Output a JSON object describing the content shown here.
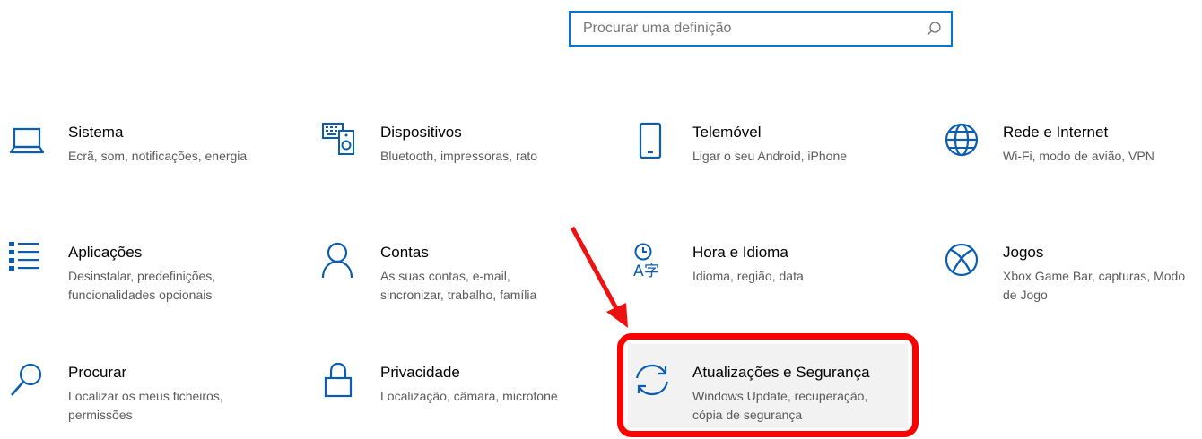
{
  "search": {
    "placeholder": "Procurar uma definição"
  },
  "tiles": [
    {
      "title": "Sistema",
      "desc": "Ecrã, som, notificações, energia",
      "icon": "laptop-icon"
    },
    {
      "title": "Dispositivos",
      "desc": "Bluetooth, impressoras, rato",
      "icon": "keyboard-speaker-icon"
    },
    {
      "title": "Telemóvel",
      "desc": "Ligar o seu Android, iPhone",
      "icon": "phone-icon"
    },
    {
      "title": "Rede e Internet",
      "desc": "Wi-Fi, modo de avião, VPN",
      "icon": "globe-icon"
    },
    {
      "title": "Aplicações",
      "desc": "Desinstalar, predefinições, funcionalidades opcionais",
      "icon": "apps-list-icon"
    },
    {
      "title": "Contas",
      "desc": "As suas contas, e-mail, sincronizar, trabalho, família",
      "icon": "person-icon"
    },
    {
      "title": "Hora e Idioma",
      "desc": "Idioma, região, data",
      "icon": "time-language-icon"
    },
    {
      "title": "Jogos",
      "desc": "Xbox Game Bar, capturas, Modo de Jogo",
      "icon": "xbox-icon"
    },
    {
      "title": "Procurar",
      "desc": "Localizar os meus ficheiros, permissões",
      "icon": "search-icon"
    },
    {
      "title": "Privacidade",
      "desc": "Localização, câmara, microfone",
      "icon": "lock-icon"
    },
    {
      "title": "Atualizações e Segurança",
      "desc": "Windows Update, recuperação, cópia de segurança",
      "icon": "sync-icon"
    }
  ],
  "colors": {
    "accent": "#0078d7",
    "highlight": "#ff0000",
    "text_secondary": "#5a5a5a"
  }
}
